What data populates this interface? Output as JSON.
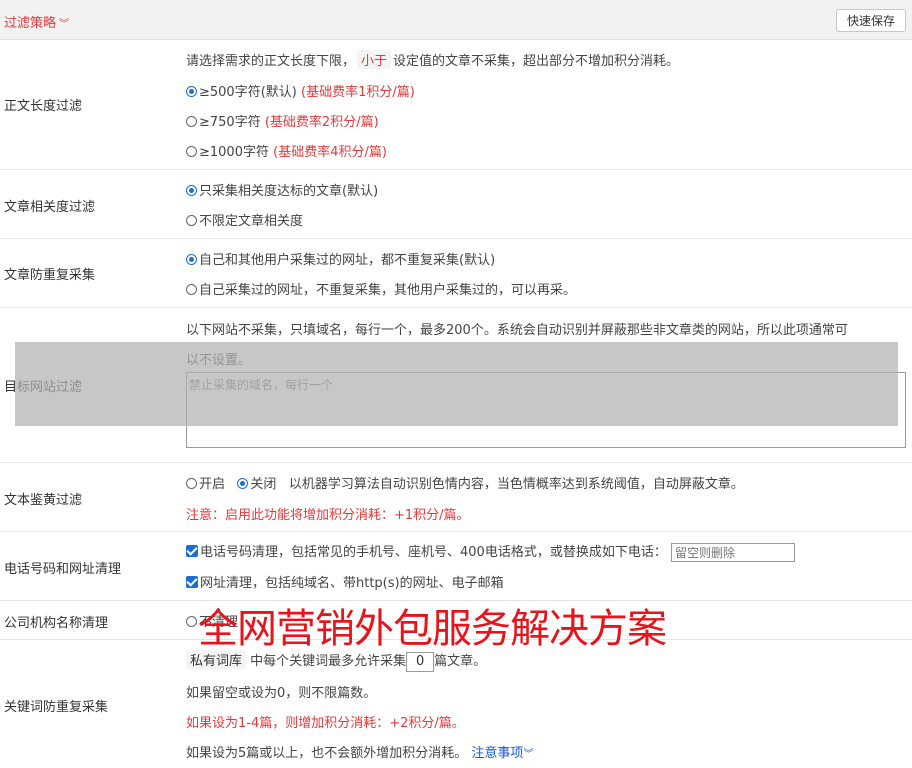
{
  "header": {
    "title": "过滤策略",
    "save_label": "快速保存"
  },
  "length_filter": {
    "label": "正文长度过滤",
    "desc_pre": "请选择需求的正文长度下限，",
    "desc_tag": "小于",
    "desc_post": "设定值的文章不采集，超出部分不增加积分消耗。",
    "options": [
      {
        "text": "≥500字符(默认)",
        "note": "(基础费率1积分/篇)",
        "selected": true
      },
      {
        "text": "≥750字符",
        "note": "(基础费率2积分/篇)",
        "selected": false
      },
      {
        "text": "≥1000字符",
        "note": "(基础费率4积分/篇)",
        "selected": false
      }
    ]
  },
  "relevance_filter": {
    "label": "文章相关度过滤",
    "options": [
      {
        "text": "只采集相关度达标的文章(默认)",
        "selected": true
      },
      {
        "text": "不限定文章相关度",
        "selected": false
      }
    ]
  },
  "dedupe": {
    "label": "文章防重复采集",
    "options": [
      {
        "text": "自己和其他用户采集过的网址，都不重复采集(默认)",
        "selected": true
      },
      {
        "text": "自己采集过的网址，不重复采集，其他用户采集过的，可以再采。",
        "selected": false
      }
    ]
  },
  "site_filter": {
    "label": "目标网站过滤",
    "desc_line1": "以下网站不采集，只填域名，每行一个，最多200个。系统会自动识别并屏蔽那些非文章类的网站，所以此项通常可",
    "desc_line2": "以不设置。",
    "placeholder": "禁止采集的域名，每行一个"
  },
  "porn_filter": {
    "label": "文本鉴黄过滤",
    "opt_on": "开启",
    "opt_off": "关闭",
    "desc": "以机器学习算法自动识别色情内容，当色情概率达到系统阈值，自动屏蔽文章。",
    "note": "注意：启用此功能将增加积分消耗：+1积分/篇。"
  },
  "phone_clean": {
    "label": "电话号码和网址清理",
    "phone_text": "电话号码清理，包括常见的手机号、座机号、400电话格式，或替换成如下电话：",
    "phone_placeholder": "留空则删除",
    "url_text": "网址清理，包括纯域名、带http(s)的网址、电子邮箱"
  },
  "company_clean": {
    "label": "公司机构名称清理",
    "partial_text": "不清理"
  },
  "keyword_dedupe": {
    "label": "关键词防重复采集",
    "tag": "私有词库",
    "text_pre": "中每个关键词最多允许采集",
    "value": "0",
    "text_post": "篇文章。",
    "line2": "如果留空或设为0，则不限篇数。",
    "line3": "如果设为1-4篇，则增加积分消耗：+2积分/篇。",
    "line4": "如果设为5篇或以上，也不会额外增加积分消耗。",
    "notice_link": "注意事项"
  },
  "watermark": "全网营销外包服务解决方案",
  "colors": {
    "accent_red": "#e4393c",
    "link_blue": "#1a56d6",
    "checkbox_blue": "#1a6fd6",
    "watermark_red": "#e8141b"
  }
}
